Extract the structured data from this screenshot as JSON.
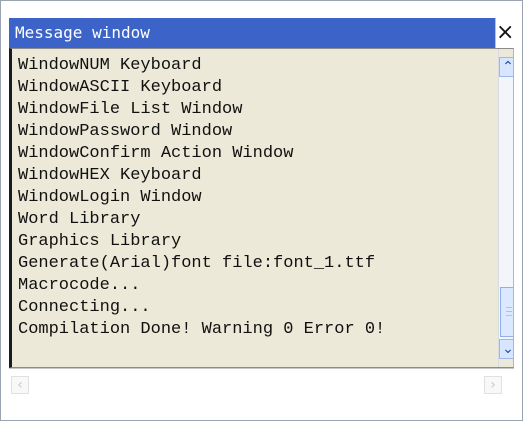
{
  "window": {
    "title": "Message window",
    "close_symbol": "×",
    "icons": {
      "close": "close-icon",
      "up": "chevron-up-icon",
      "down": "chevron-down-icon",
      "left": "chevron-left-icon",
      "right": "chevron-right-icon"
    },
    "colors": {
      "title_bar": "#3c63c7",
      "content_background": "#ece9d8",
      "scrollbar_accent": "#dce8ff"
    }
  },
  "messages": [
    "WindowNUM Keyboard",
    "WindowASCII Keyboard",
    "WindowFile List Window",
    "WindowPassword Window",
    "WindowConfirm Action Window",
    "WindowHEX Keyboard",
    "WindowLogin Window",
    "Word Library",
    "Graphics Library",
    "Generate(Arial)font file:font_1.ttf",
    "Macrocode...",
    "Connecting...",
    "Compilation Done! Warning 0 Error 0!"
  ],
  "scrollbars": {
    "vertical": {
      "up_symbol": "⌃",
      "down_symbol": "⌄",
      "position": 0.92
    },
    "horizontal": {
      "left_symbol": "‹",
      "right_symbol": "›"
    }
  }
}
